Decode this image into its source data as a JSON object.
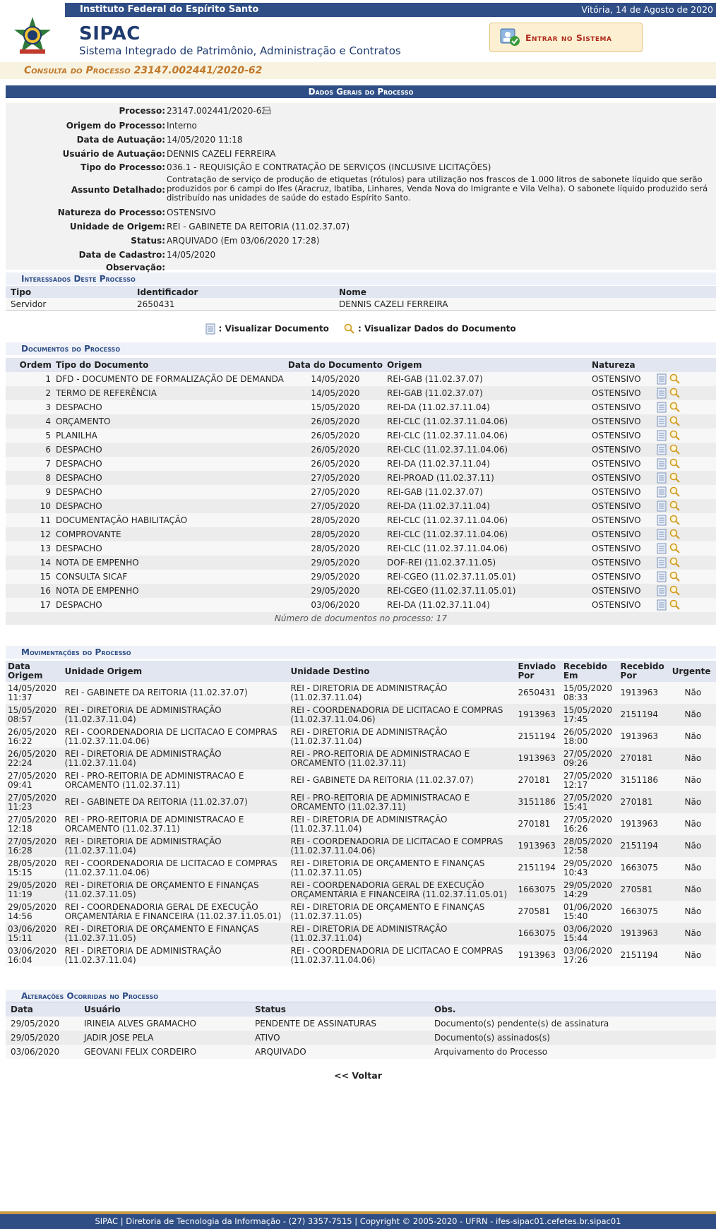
{
  "header": {
    "institution": "Instituto Federal do Espírito Santo",
    "date": "Vitória, 14 de Agosto de 2020",
    "app_name": "SIPAC",
    "app_subtitle": "Sistema Integrado de Patrimônio, Administração e Contratos",
    "login_label": "Entrar no Sistema",
    "page_title": "Consulta do Processo 23147.002441/2020-62"
  },
  "general": {
    "caption": "Dados Gerais do Processo",
    "fields": [
      {
        "label": "Processo:",
        "value": "23147.002441/2020-62"
      },
      {
        "label": "Origem do Processo:",
        "value": "Interno"
      },
      {
        "label": "Data de Autuação:",
        "value": "14/05/2020 11:18"
      },
      {
        "label": "Usuário de Autuação:",
        "value": "DENNIS CAZELI FERREIRA"
      },
      {
        "label": "Tipo do Processo:",
        "value": "036.1 - REQUISIÇÃO E CONTRATAÇÃO DE SERVIÇOS (INCLUSIVE LICITAÇÕES)"
      },
      {
        "label": "Assunto Detalhado:",
        "value": "Contratação de serviço de produção de etiquetas (rótulos) para utilização nos frascos de 1.000 litros de sabonete líquido que serão produzidos por 6 campi do Ifes (Aracruz, Ibatiba, Linhares, Venda Nova do Imigrante e Vila Velha). O sabonete líquido produzido será distribuído nas unidades de saúde do estado Espírito Santo."
      },
      {
        "label": "Natureza do Processo:",
        "value": "OSTENSIVO"
      },
      {
        "label": "Unidade de Origem:",
        "value": "REI - GABINETE DA REITORIA (11.02.37.07)"
      },
      {
        "label": "Status:",
        "value": "ARQUIVADO (Em 03/06/2020 17:28)"
      },
      {
        "label": "Data de Cadastro:",
        "value": "14/05/2020"
      },
      {
        "label": "Observação:",
        "value": ""
      }
    ]
  },
  "interested": {
    "caption": "Interessados Deste Processo",
    "headers": [
      "Tipo",
      "Identificador",
      "Nome"
    ],
    "rows": [
      [
        "Servidor",
        "2650431",
        "DENNIS CAZELI FERREIRA"
      ]
    ]
  },
  "legend": {
    "view_document": ": Visualizar Documento",
    "view_data": ": Visualizar Dados do Documento"
  },
  "documents": {
    "caption": "Documentos do Processo",
    "headers": [
      "Ordem",
      "Tipo do Documento",
      "Data do Documento",
      "Origem",
      "Natureza"
    ],
    "rows": [
      [
        "1",
        "DFD - DOCUMENTO DE FORMALIZAÇÃO DE DEMANDA",
        "14/05/2020",
        "REI-GAB (11.02.37.07)",
        "OSTENSIVO"
      ],
      [
        "2",
        "TERMO DE REFERÊNCIA",
        "14/05/2020",
        "REI-GAB (11.02.37.07)",
        "OSTENSIVO"
      ],
      [
        "3",
        "DESPACHO",
        "15/05/2020",
        "REI-DA (11.02.37.11.04)",
        "OSTENSIVO"
      ],
      [
        "4",
        "ORÇAMENTO",
        "26/05/2020",
        "REI-CLC (11.02.37.11.04.06)",
        "OSTENSIVO"
      ],
      [
        "5",
        "PLANILHA",
        "26/05/2020",
        "REI-CLC (11.02.37.11.04.06)",
        "OSTENSIVO"
      ],
      [
        "6",
        "DESPACHO",
        "26/05/2020",
        "REI-CLC (11.02.37.11.04.06)",
        "OSTENSIVO"
      ],
      [
        "7",
        "DESPACHO",
        "26/05/2020",
        "REI-DA (11.02.37.11.04)",
        "OSTENSIVO"
      ],
      [
        "8",
        "DESPACHO",
        "27/05/2020",
        "REI-PROAD (11.02.37.11)",
        "OSTENSIVO"
      ],
      [
        "9",
        "DESPACHO",
        "27/05/2020",
        "REI-GAB (11.02.37.07)",
        "OSTENSIVO"
      ],
      [
        "10",
        "DESPACHO",
        "27/05/2020",
        "REI-DA (11.02.37.11.04)",
        "OSTENSIVO"
      ],
      [
        "11",
        "DOCUMENTAÇÃO HABILITAÇÃO",
        "28/05/2020",
        "REI-CLC (11.02.37.11.04.06)",
        "OSTENSIVO"
      ],
      [
        "12",
        "COMPROVANTE",
        "28/05/2020",
        "REI-CLC (11.02.37.11.04.06)",
        "OSTENSIVO"
      ],
      [
        "13",
        "DESPACHO",
        "28/05/2020",
        "REI-CLC (11.02.37.11.04.06)",
        "OSTENSIVO"
      ],
      [
        "14",
        "NOTA DE EMPENHO",
        "29/05/2020",
        "DOF-REI (11.02.37.11.05)",
        "OSTENSIVO"
      ],
      [
        "15",
        "CONSULTA SICAF",
        "29/05/2020",
        "REI-CGEO (11.02.37.11.05.01)",
        "OSTENSIVO"
      ],
      [
        "16",
        "NOTA DE EMPENHO",
        "29/05/2020",
        "REI-CGEO (11.02.37.11.05.01)",
        "OSTENSIVO"
      ],
      [
        "17",
        "DESPACHO",
        "03/06/2020",
        "REI-DA (11.02.37.11.04)",
        "OSTENSIVO"
      ]
    ],
    "count_text": "Número de documentos no processo: 17"
  },
  "movements": {
    "caption": "Movimentações do Processo",
    "headers": [
      "Data Origem",
      "Unidade Origem",
      "Unidade Destino",
      "Enviado Por",
      "Recebido Em",
      "Recebido Por",
      "Urgente"
    ],
    "rows": [
      [
        "14/05/2020 11:37",
        "REI - GABINETE DA REITORIA (11.02.37.07)",
        "REI - DIRETORIA DE ADMINISTRAÇÃO (11.02.37.11.04)",
        "2650431",
        "15/05/2020 08:33",
        "1913963",
        "Não"
      ],
      [
        "15/05/2020 08:57",
        "REI - DIRETORIA DE ADMINISTRAÇÃO (11.02.37.11.04)",
        "REI - COORDENADORIA DE LICITACAO E COMPRAS (11.02.37.11.04.06)",
        "1913963",
        "15/05/2020 17:45",
        "2151194",
        "Não"
      ],
      [
        "26/05/2020 16:22",
        "REI - COORDENADORIA DE LICITACAO E COMPRAS (11.02.37.11.04.06)",
        "REI - DIRETORIA DE ADMINISTRAÇÃO (11.02.37.11.04)",
        "2151194",
        "26/05/2020 18:00",
        "1913963",
        "Não"
      ],
      [
        "26/05/2020 22:24",
        "REI - DIRETORIA DE ADMINISTRAÇÃO (11.02.37.11.04)",
        "REI - PRO-REITORIA DE ADMINISTRACAO E ORCAMENTO (11.02.37.11)",
        "1913963",
        "27/05/2020 09:26",
        "270181",
        "Não"
      ],
      [
        "27/05/2020 09:41",
        "REI - PRO-REITORIA DE ADMINISTRACAO E ORCAMENTO (11.02.37.11)",
        "REI - GABINETE DA REITORIA (11.02.37.07)",
        "270181",
        "27/05/2020 12:17",
        "3151186",
        "Não"
      ],
      [
        "27/05/2020 11:23",
        "REI - GABINETE DA REITORIA (11.02.37.07)",
        "REI - PRO-REITORIA DE ADMINISTRACAO E ORCAMENTO (11.02.37.11)",
        "3151186",
        "27/05/2020 15:41",
        "270181",
        "Não"
      ],
      [
        "27/05/2020 12:18",
        "REI - PRO-REITORIA DE ADMINISTRACAO E ORCAMENTO (11.02.37.11)",
        "REI - DIRETORIA DE ADMINISTRAÇÃO (11.02.37.11.04)",
        "270181",
        "27/05/2020 16:26",
        "1913963",
        "Não"
      ],
      [
        "27/05/2020 16:28",
        "REI - DIRETORIA DE ADMINISTRAÇÃO (11.02.37.11.04)",
        "REI - COORDENADORIA DE LICITACAO E COMPRAS (11.02.37.11.04.06)",
        "1913963",
        "28/05/2020 12:58",
        "2151194",
        "Não"
      ],
      [
        "28/05/2020 15:15",
        "REI - COORDENADORIA DE LICITACAO E COMPRAS (11.02.37.11.04.06)",
        "REI - DIRETORIA DE ORÇAMENTO E FINANÇAS (11.02.37.11.05)",
        "2151194",
        "29/05/2020 10:43",
        "1663075",
        "Não"
      ],
      [
        "29/05/2020 11:19",
        "REI - DIRETORIA DE ORÇAMENTO E FINANÇAS (11.02.37.11.05)",
        "REI - COORDENADORIA GERAL DE EXECUÇÃO ORÇAMENTÁRIA E FINANCEIRA (11.02.37.11.05.01)",
        "1663075",
        "29/05/2020 14:29",
        "270581",
        "Não"
      ],
      [
        "29/05/2020 14:56",
        "REI - COORDENADORIA GERAL DE EXECUÇÃO ORÇAMENTÁRIA E FINANCEIRA (11.02.37.11.05.01)",
        "REI - DIRETORIA DE ORÇAMENTO E FINANÇAS (11.02.37.11.05)",
        "270581",
        "01/06/2020 15:40",
        "1663075",
        "Não"
      ],
      [
        "03/06/2020 15:11",
        "REI - DIRETORIA DE ORÇAMENTO E FINANÇAS (11.02.37.11.05)",
        "REI - DIRETORIA DE ADMINISTRAÇÃO (11.02.37.11.04)",
        "1663075",
        "03/06/2020 15:44",
        "1913963",
        "Não"
      ],
      [
        "03/06/2020 16:04",
        "REI - DIRETORIA DE ADMINISTRAÇÃO (11.02.37.11.04)",
        "REI - COORDENADORIA DE LICITACAO E COMPRAS (11.02.37.11.04.06)",
        "1913963",
        "03/06/2020 17:26",
        "2151194",
        "Não"
      ]
    ]
  },
  "changes": {
    "caption": "Alterações Ocorridas no Processo",
    "headers": [
      "Data",
      "Usuário",
      "Status",
      "Obs."
    ],
    "rows": [
      [
        "29/05/2020",
        "IRINEIA ALVES GRAMACHO",
        "PENDENTE DE ASSINATURAS",
        "Documento(s) pendente(s) de assinatura"
      ],
      [
        "29/05/2020",
        "JADIR JOSE PELA",
        "ATIVO",
        "Documento(s) assinados(s)"
      ],
      [
        "03/06/2020",
        "GEOVANI FELIX CORDEIRO",
        "ARQUIVADO",
        "Arquivamento do Processo"
      ]
    ]
  },
  "back_label": "<< Voltar",
  "footer": "SIPAC | Diretoria de Tecnologia da Informação - (27) 3357-7515 | Copyright © 2005-2020 - UFRN - ifes-sipac01.cefetes.br.sipac01"
}
